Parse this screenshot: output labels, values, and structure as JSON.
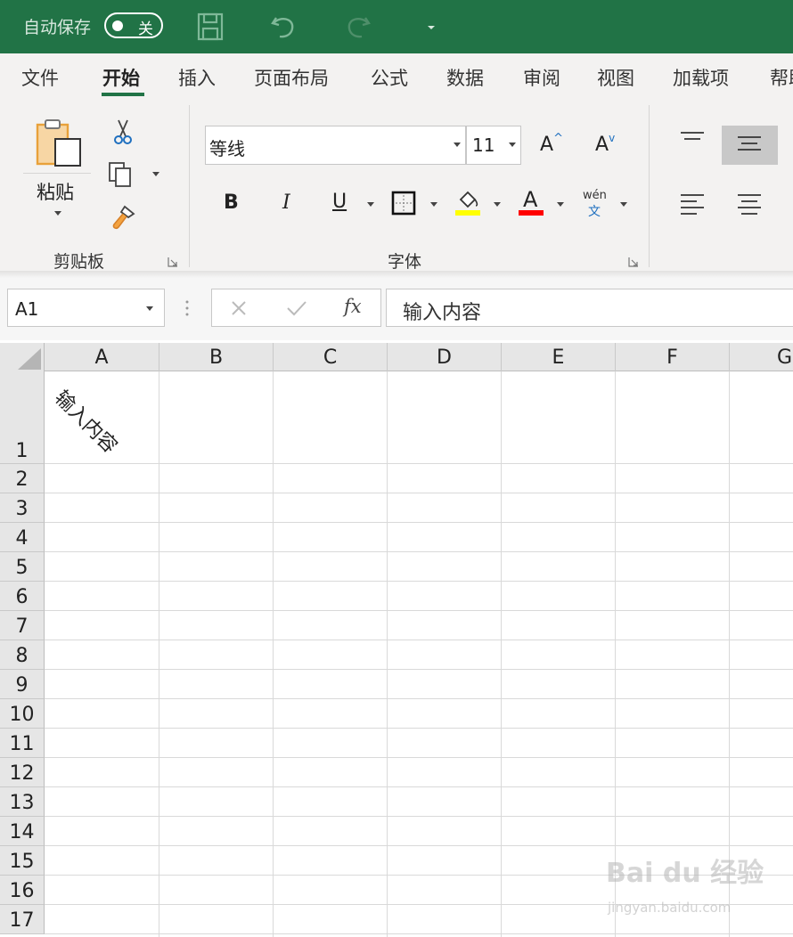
{
  "titlebar": {
    "autosave_label": "自动保存",
    "autosave_state": "关"
  },
  "tabs": [
    {
      "label": "文件"
    },
    {
      "label": "开始"
    },
    {
      "label": "插入"
    },
    {
      "label": "页面布局"
    },
    {
      "label": "公式"
    },
    {
      "label": "数据"
    },
    {
      "label": "审阅"
    },
    {
      "label": "视图"
    },
    {
      "label": "加载项"
    },
    {
      "label": "帮助"
    }
  ],
  "ribbon": {
    "clipboard": {
      "paste_label": "粘贴",
      "group_label": "剪贴板"
    },
    "font": {
      "font_name": "等线",
      "font_size": "11",
      "grow_label": "A",
      "shrink_label": "A",
      "bold_label": "B",
      "italic_label": "I",
      "underline_label": "U",
      "font_color_label": "A",
      "phonetic_top": "wén",
      "phonetic_bottom": "文",
      "group_label": "字体"
    },
    "colors": {
      "highlight": "#ffff00",
      "font_color": "#ff0000",
      "accent": "#217346"
    }
  },
  "formula_bar": {
    "name_box": "A1",
    "fx_label": "fx",
    "content": "输入内容"
  },
  "sheet": {
    "columns": [
      "A",
      "B",
      "C",
      "D",
      "E",
      "F",
      "G"
    ],
    "rows": [
      "1",
      "2",
      "3",
      "4",
      "5",
      "6",
      "7",
      "8",
      "9",
      "10",
      "11",
      "12",
      "13",
      "14",
      "15",
      "16",
      "17"
    ],
    "cell_a1": "输入内容"
  },
  "watermark": {
    "brand": "Bai du 经验",
    "url": "jingyan.baidu.com"
  }
}
